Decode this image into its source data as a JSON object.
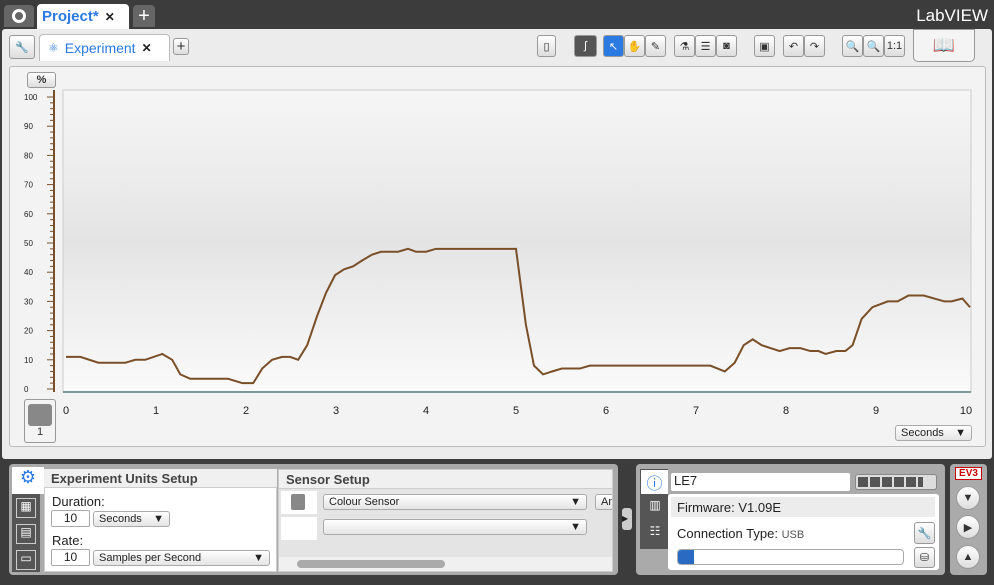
{
  "tabs": {
    "project": "Project*",
    "close": "✕",
    "add": "+"
  },
  "brand": "LabVIEW",
  "subtabs": {
    "experiment": "Experiment",
    "close": "✕",
    "add": "+"
  },
  "chart_data": {
    "type": "line",
    "ylabel": "%",
    "xlabel": "",
    "x_unit_select": "Seconds",
    "xlim": [
      0,
      10
    ],
    "ylim": [
      0,
      100
    ],
    "xticks": [
      "0",
      "1",
      "2",
      "3",
      "4",
      "5",
      "6",
      "7",
      "8",
      "9",
      "10"
    ],
    "yticks": [
      "100",
      "90",
      "80",
      "70",
      "60",
      "50",
      "40",
      "30",
      "20",
      "10",
      "0"
    ],
    "color": "#7a4f28",
    "x": [
      0,
      0.16,
      0.36,
      0.66,
      0.77,
      0.88,
      1.07,
      1.18,
      1.27,
      1.38,
      1.8,
      1.96,
      2.08,
      2.18,
      2.29,
      2.4,
      2.49,
      2.58,
      2.68,
      2.79,
      2.89,
      2.99,
      3.09,
      3.19,
      3.29,
      3.4,
      3.5,
      3.69,
      3.8,
      3.89,
      4.0,
      4.11,
      5.0,
      5.11,
      5.2,
      5.3,
      5.4,
      5.51,
      5.71,
      5.82,
      7.16,
      7.32,
      7.43,
      7.53,
      7.63,
      7.73,
      7.93,
      8.04,
      8.16,
      8.27,
      8.36,
      8.44,
      8.56,
      8.66,
      8.74,
      8.84,
      8.96,
      9.13,
      9.24,
      9.36,
      9.53,
      9.76,
      9.84,
      9.96,
      10.05
    ],
    "y": [
      11,
      11,
      9,
      9,
      10,
      10,
      12,
      10,
      5,
      3.5,
      3.5,
      2,
      2,
      7,
      10,
      11,
      11,
      10,
      15,
      25,
      33,
      39,
      41,
      42,
      44,
      46,
      47,
      47,
      48,
      47,
      47,
      48,
      48,
      22,
      8,
      5,
      6,
      7,
      7,
      8,
      8,
      6,
      9,
      15,
      17,
      15,
      13,
      14,
      14,
      13,
      13,
      12,
      13,
      13,
      15,
      24,
      28,
      30,
      30,
      32,
      32,
      30,
      30,
      31,
      28
    ]
  },
  "sensor_port": "1",
  "setup": {
    "units_title": "Experiment Units Setup",
    "duration_label": "Duration:",
    "duration_value": "10",
    "duration_unit": "Seconds",
    "rate_label": "Rate:",
    "rate_value": "10",
    "rate_unit": "Samples per Second",
    "sensor_title": "Sensor Setup",
    "sensor1": "Colour Sensor",
    "sensor1_mode": "Am",
    "sensor2": ""
  },
  "brick": {
    "name": "LE7",
    "firmware": "Firmware: V1.09E",
    "connection_label": "Connection Type:",
    "connection_value": "USB",
    "battery_level": 0.85,
    "memory_used": 0.07,
    "badge": "EV3"
  }
}
